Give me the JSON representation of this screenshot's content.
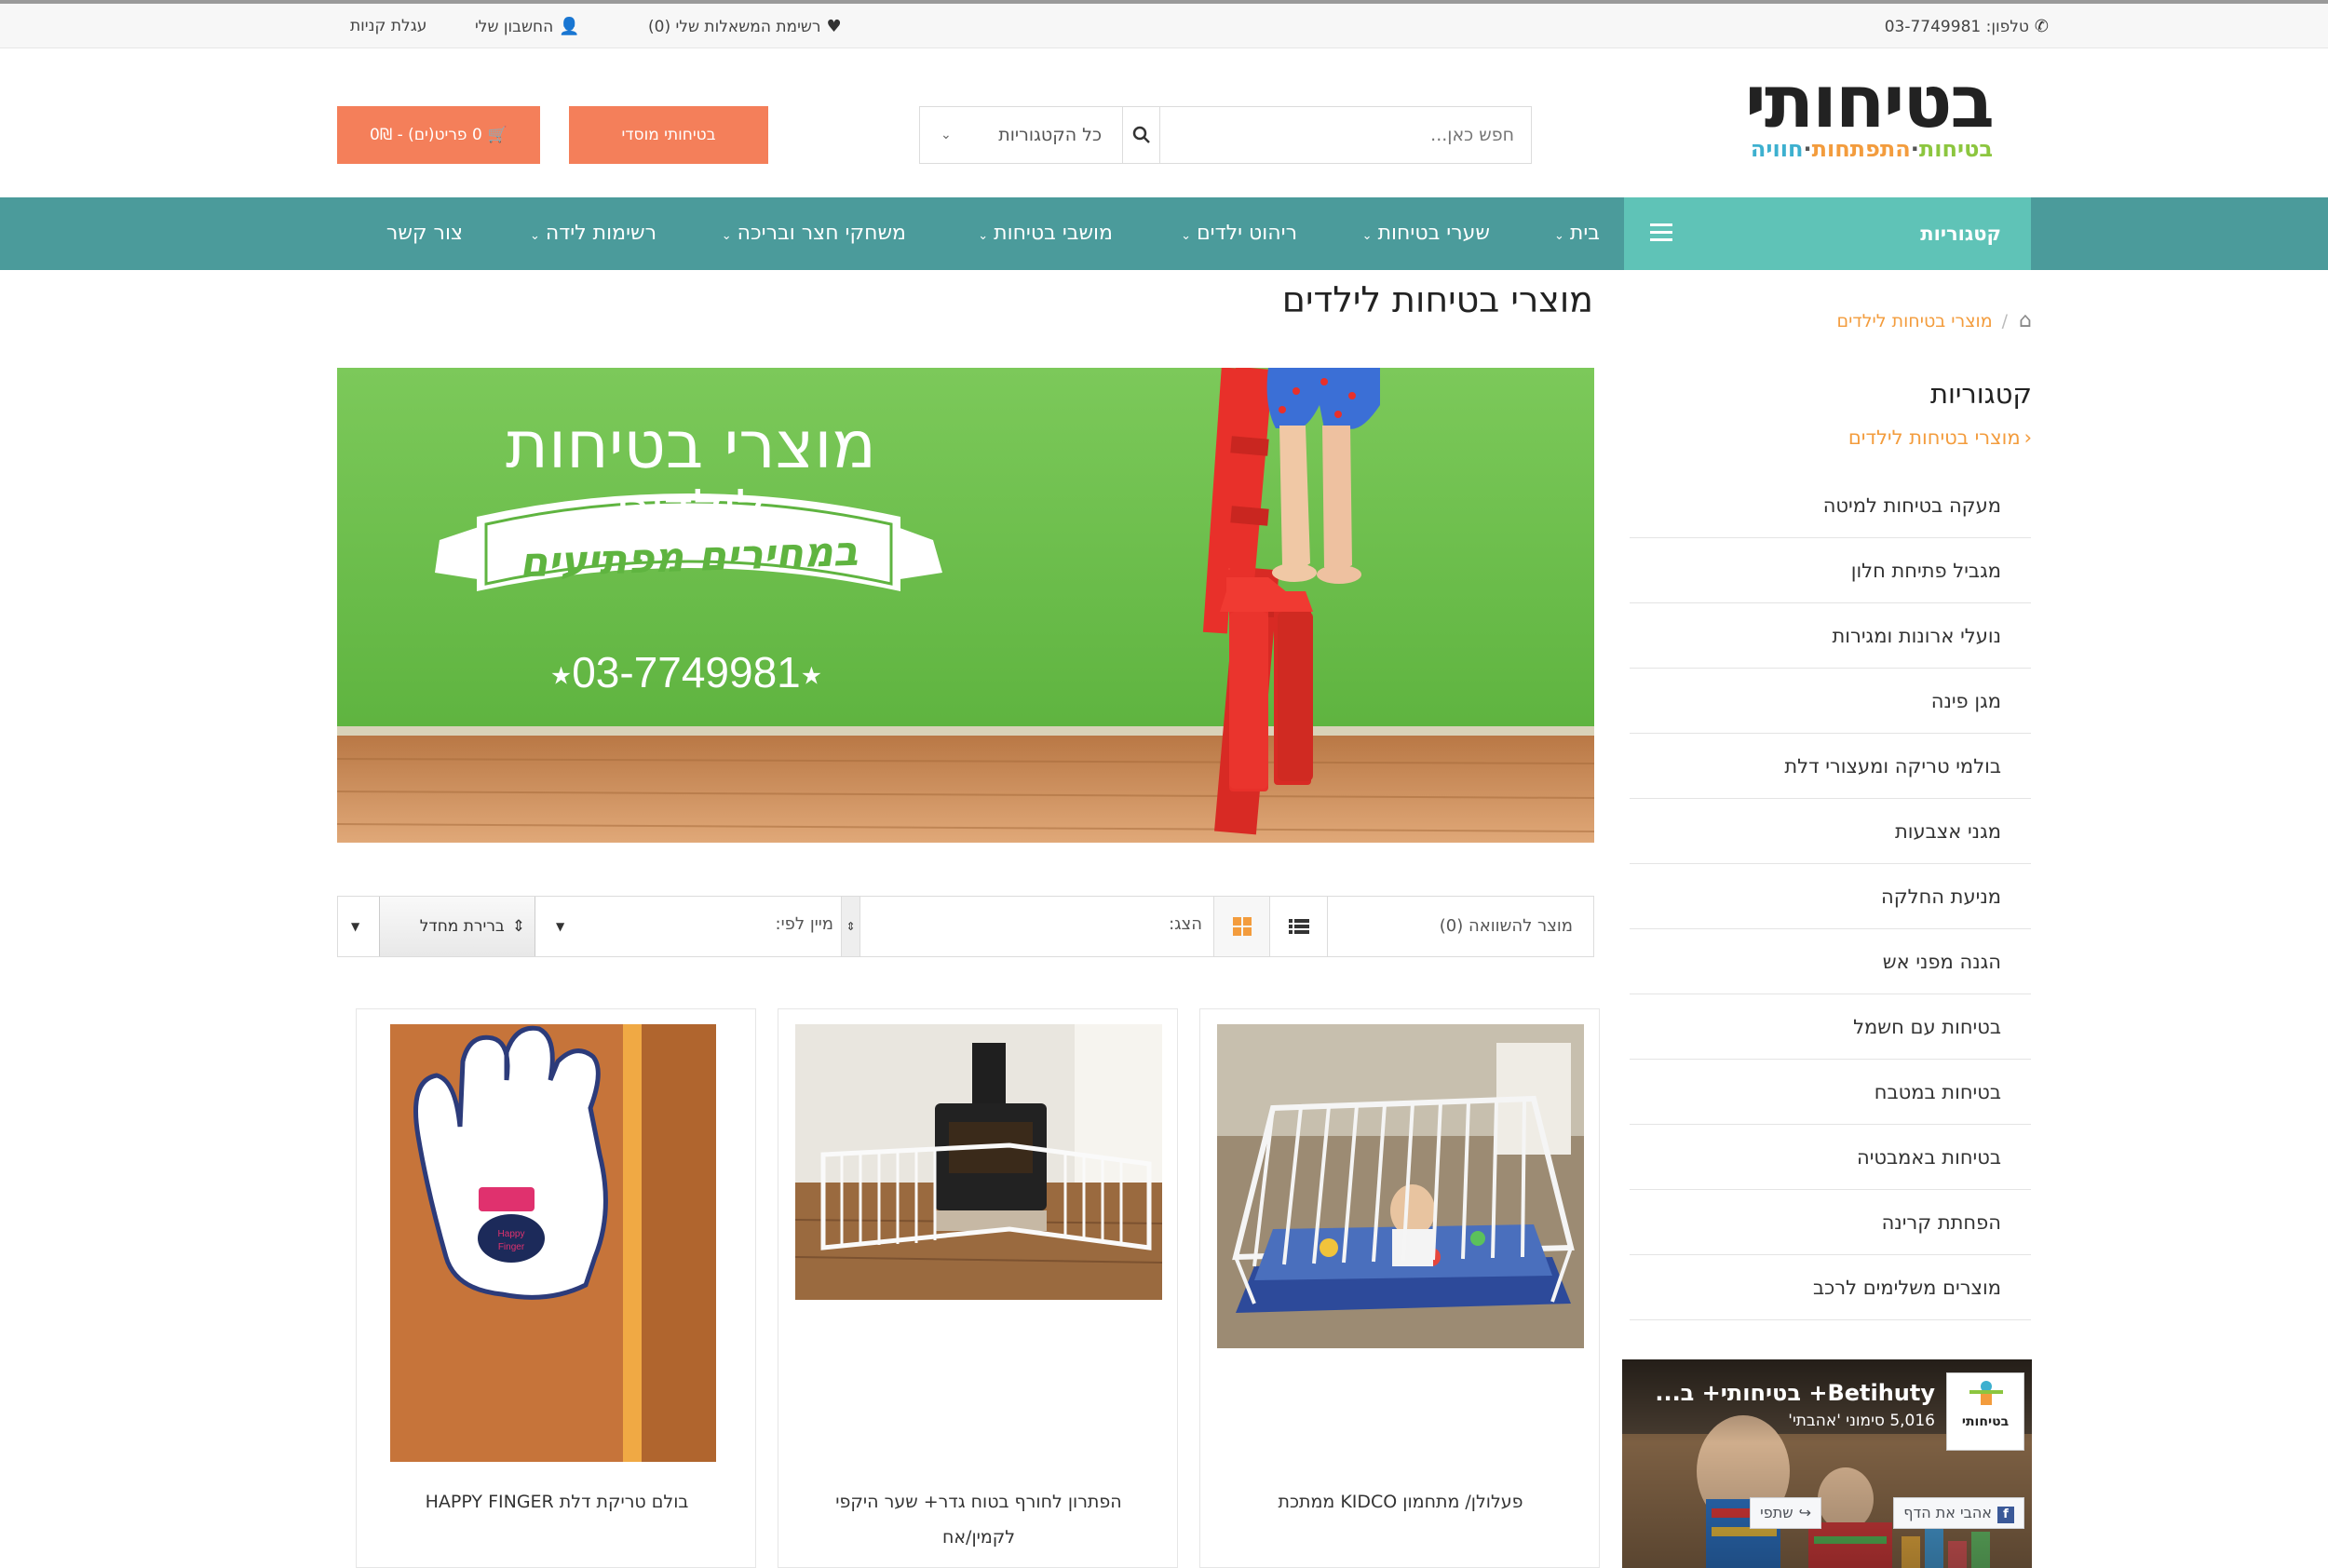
{
  "topbar": {
    "phone": "טלפון: 03-7749981",
    "wishlist": "רשימת המשאלות שלי (0)",
    "account": "החשבון שלי",
    "cart": "עגלת קניות"
  },
  "header": {
    "logo_text": "בטיחותי",
    "tag_1": "בטיחות",
    "tag_2": "התפתחות",
    "tag_3": "חוויה",
    "search_placeholder": "חפש כאן...",
    "category_select": "כל הקטגוריות",
    "institutional_button": "בטיחותי מוסדי",
    "cart_button": "0 פריט(ים) - 0₪"
  },
  "nav": {
    "categories_label": "קטגוריות",
    "items": [
      "בית",
      "שערי בטיחות",
      "ריהוט ילדים",
      "מושבי בטיחות",
      "משחקי חצר ובריכה",
      "רשימות לידה",
      "צור קשר"
    ]
  },
  "breadcrumb": {
    "current": "מוצרי בטיחות לילדים"
  },
  "sidebar": {
    "title": "קטגוריות",
    "current": "מוצרי בטיחות לילדים",
    "items": [
      "מעקה בטיחות למיטה",
      "מגביל פתיחת חלון",
      "נועלי ארונות ומגירות",
      "מגן פינה",
      "בולמי טריקה ומעצורי דלת",
      "מגני אצבעות",
      "מניעת החלקה",
      "הגנה מפני אש",
      "בטיחות עם חשמל",
      "בטיחות במטבח",
      "בטיחות באמבטיה",
      "הפחתת קרינה",
      "מוצרים משלימים לרכב"
    ],
    "fb": {
      "page_name": "Betihuty+ בטיחותי+ ב...",
      "likes": "5,016 סימוני 'אהבתי'",
      "logo_text": "בטיחותי",
      "like_button": "אהבי את הדף",
      "share_button": "שתפי"
    }
  },
  "main": {
    "title": "מוצרי בטיחות לילדים",
    "banner": {
      "line1": "מוצרי בטיחות",
      "line2": "לילדים",
      "ribbon": "במחירים מפתיעים",
      "phone": "03-7749981"
    },
    "toolbar": {
      "compare": "מוצר להשוואה (0)",
      "show_label": "הצג:",
      "sort_label": "מיין לפי:",
      "sort_value": "ברירת מחדל"
    },
    "products": [
      {
        "name": "פעלולן/ מתחמון KIDCO ממתכת"
      },
      {
        "name": "הפתרון לחורף בטוח גדר+ שער היקפי לקמין/אח"
      },
      {
        "name": "בולם טריקת דלת HAPPY FINGER"
      }
    ]
  },
  "colors": {
    "nav_bg": "#4b9b9b",
    "nav_categories_bg": "#5fc3b7",
    "accent_orange": "#f47f5a",
    "link_orange": "#f39c3d",
    "banner_green": "#6cc04a"
  }
}
